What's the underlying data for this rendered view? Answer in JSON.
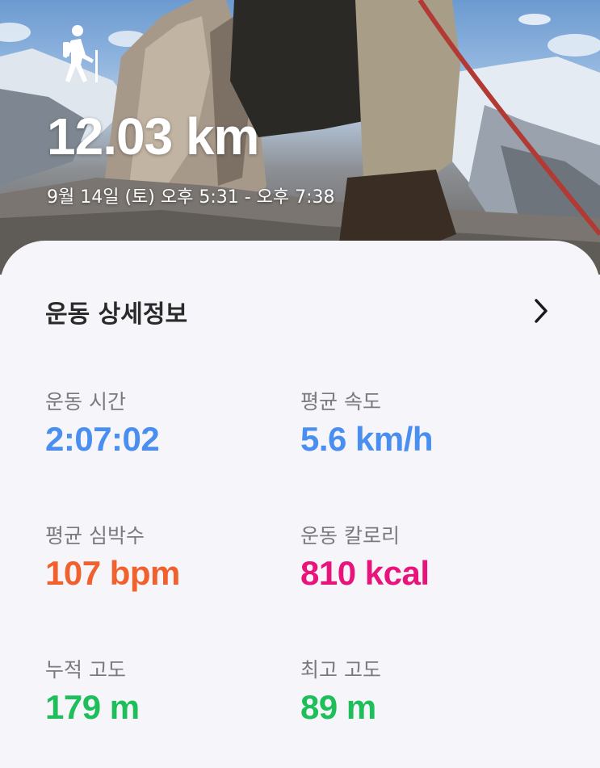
{
  "header": {
    "activity_icon": "hiking-icon",
    "distance": "12.03 km",
    "datetime": "9월 14일 (토) 오후 5:31 - 오후 7:38"
  },
  "details": {
    "title": "운동 상세정보",
    "chevron_icon": "chevron-right-icon",
    "stats": {
      "duration": {
        "label": "운동 시간",
        "value": "2:07:02",
        "color": "#4a8ff0"
      },
      "avg_speed": {
        "label": "평균 속도",
        "value": "5.6 km/h",
        "color": "#4a8ff0"
      },
      "avg_heart_rate": {
        "label": "평균 심박수",
        "value": "107 bpm",
        "color": "#f0612d"
      },
      "calories": {
        "label": "운동 칼로리",
        "value": "810 kcal",
        "color": "#e9137c"
      },
      "cumulative_altitude": {
        "label": "누적 고도",
        "value": "179 m",
        "color": "#1ebf5b"
      },
      "max_altitude": {
        "label": "최고 고도",
        "value": "89 m",
        "color": "#1ebf5b"
      }
    }
  }
}
